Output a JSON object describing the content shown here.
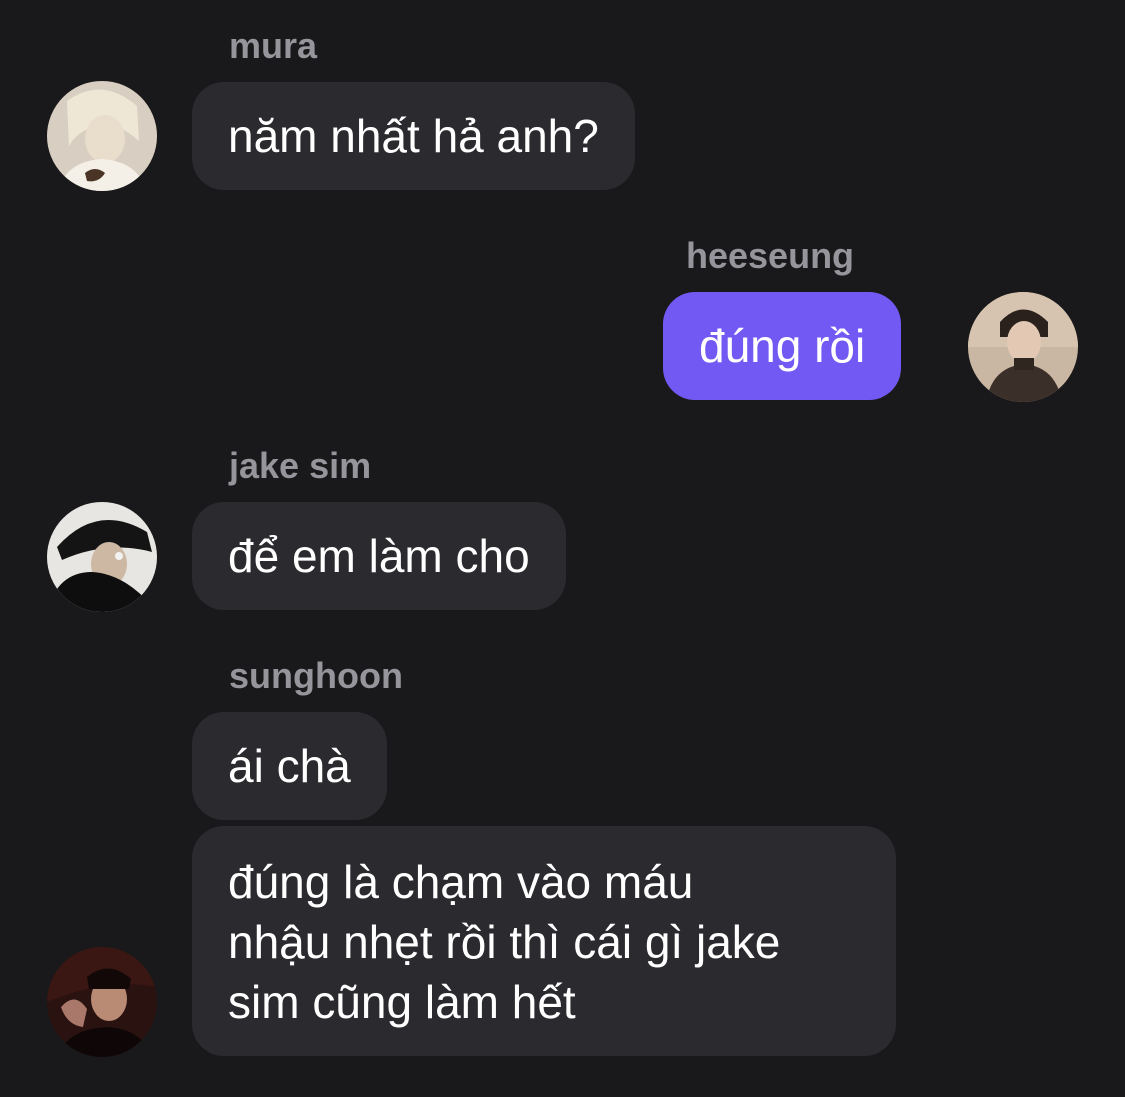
{
  "messages": [
    {
      "sender": "mura",
      "avatar_icon": "avatar-mura-icon",
      "direction": "incoming",
      "text": "năm nhất hả anh?"
    },
    {
      "sender": "heeseung",
      "avatar_icon": "avatar-heeseung-icon",
      "direction": "outgoing",
      "text": "đúng rồi"
    },
    {
      "sender": "jake sim",
      "avatar_icon": "avatar-jake-icon",
      "direction": "incoming",
      "text": "để em làm cho"
    },
    {
      "sender": "sunghoon",
      "avatar_icon": "avatar-sunghoon-icon",
      "direction": "incoming",
      "texts": [
        "ái chà",
        [
          "đúng là chạm vào máu",
          "nhậu nhẹt rồi thì cái gì jake",
          "sim cũng làm hết"
        ]
      ]
    }
  ],
  "colors": {
    "background": "#19191b",
    "incoming_bubble": "#2b2b2f",
    "outgoing_bubble": "#7359f3",
    "sender_name": "#96959b",
    "message_text": "#ffffff"
  }
}
